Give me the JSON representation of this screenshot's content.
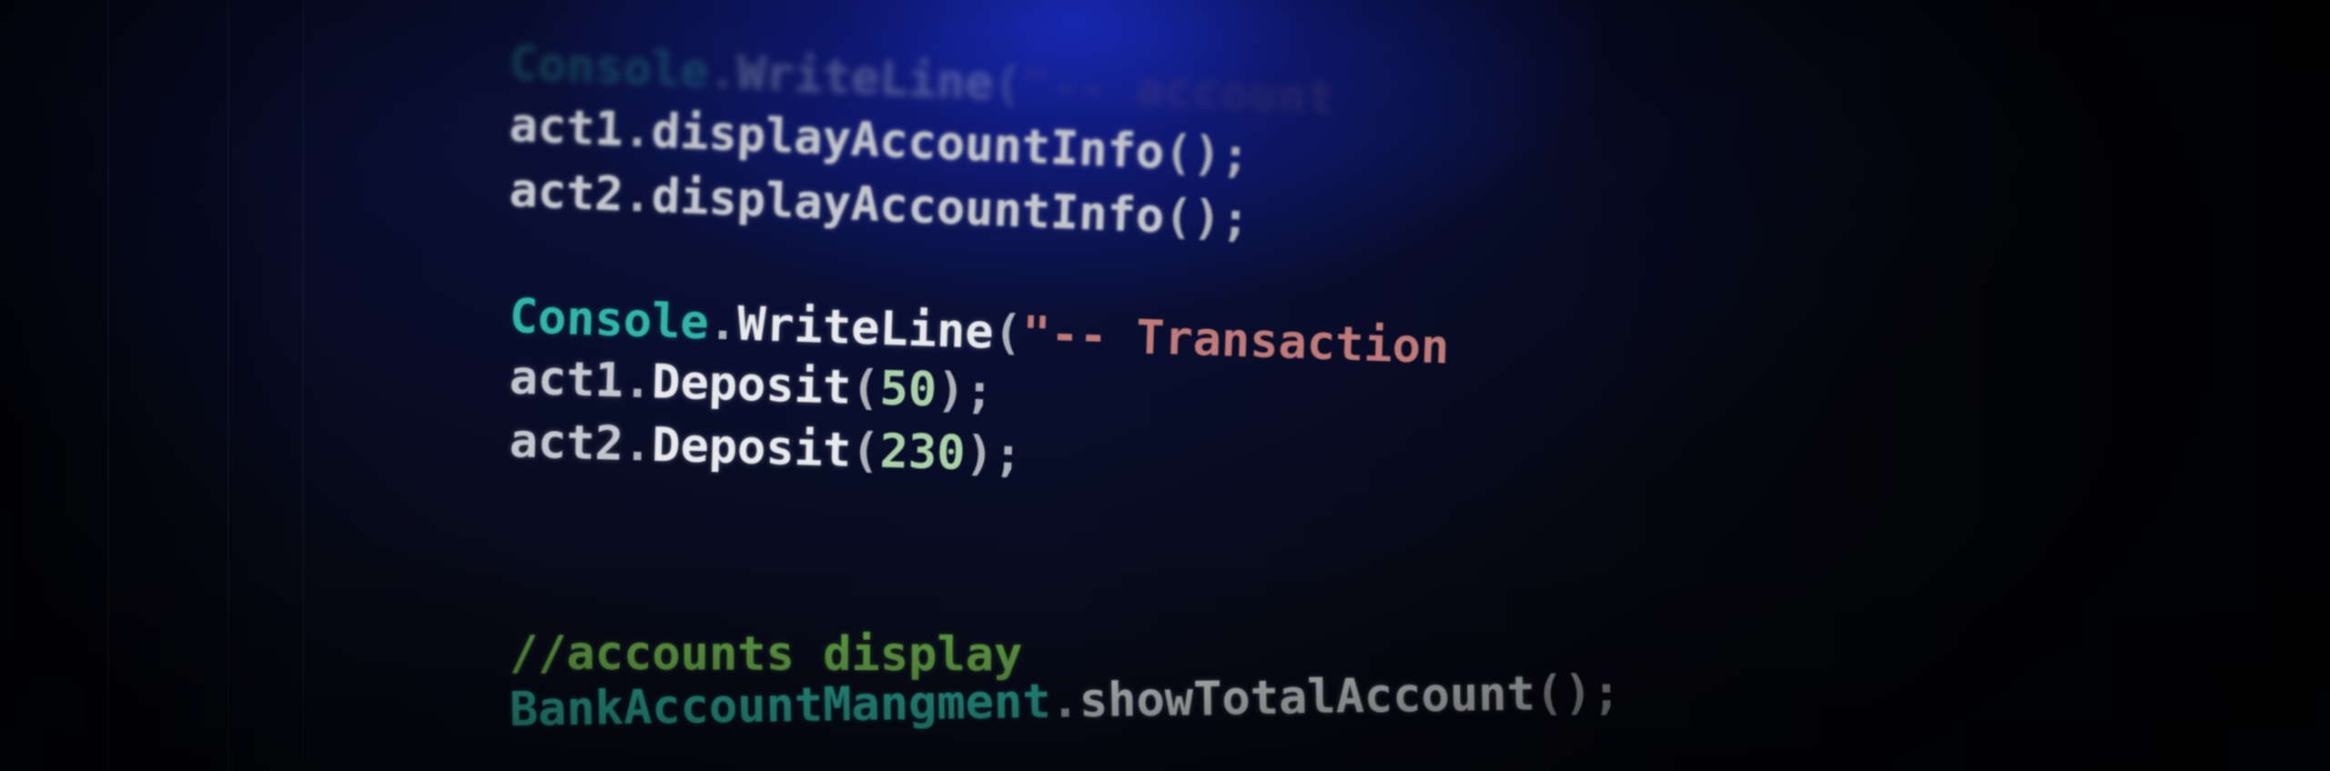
{
  "editor": {
    "language": "C#",
    "colors": {
      "background": "#080c1d",
      "glow": "#1c30d7",
      "identifier": "#c3c6cc",
      "class_name": "#2fb6a6",
      "method": "#e7e9ec",
      "string": "#c07a78",
      "number": "#a9d3a6",
      "comment": "#6cb24b"
    },
    "lines": {
      "line1": {
        "object": "Console",
        "dot": ".",
        "method": "WriteLine",
        "open": "(",
        "string": "\"-- account"
      },
      "line2": {
        "object": "act1",
        "dot": ".",
        "method": "displayAccountInfo",
        "rest": "();"
      },
      "line3": {
        "object": "act2",
        "dot": ".",
        "method": "displayAccountInfo",
        "rest": "();"
      },
      "line4": {
        "object": "Console",
        "dot": ".",
        "method": "WriteLine",
        "open": "(",
        "string": "\"-- Transaction"
      },
      "line5": {
        "object": "act1",
        "dot": ".",
        "method": "Deposit",
        "open": "(",
        "arg": "50",
        "close": ");"
      },
      "line6": {
        "object": "act2",
        "dot": ".",
        "method": "Deposit",
        "open": "(",
        "arg": "230",
        "close": ");"
      },
      "line7": {
        "comment": "//accounts display"
      },
      "line8": {
        "object": "BankAccountMangment",
        "dot": ".",
        "method": "showTotalAccount",
        "rest": "();"
      }
    }
  }
}
